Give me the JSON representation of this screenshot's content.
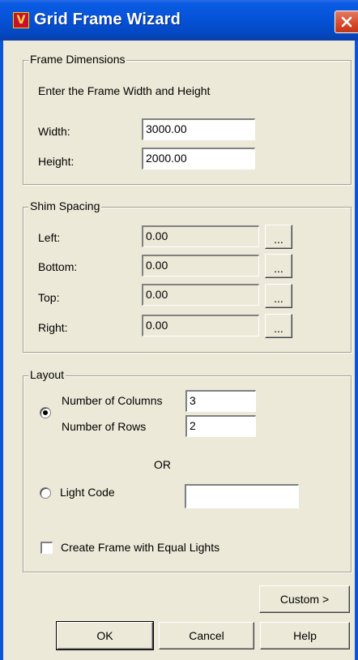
{
  "window": {
    "title": "Grid Frame Wizard",
    "icon": "app-logo-icon",
    "icon_letter": "V",
    "close_icon": "close-icon"
  },
  "frame_dimensions": {
    "group_label": "Frame Dimensions",
    "instructions": "Enter the Frame Width and Height",
    "width_label": "Width:",
    "width_value": "3000.00",
    "height_label": "Height:",
    "height_value": "2000.00"
  },
  "shim_spacing": {
    "group_label": "Shim Spacing",
    "rows": [
      {
        "label": "Left:",
        "value": "0.00",
        "button": "..."
      },
      {
        "label": "Bottom:",
        "value": "0.00",
        "button": "..."
      },
      {
        "label": "Top:",
        "value": "0.00",
        "button": "..."
      },
      {
        "label": "Right:",
        "value": "0.00",
        "button": "..."
      }
    ]
  },
  "layout": {
    "group_label": "Layout",
    "columns_label": "Number of Columns",
    "columns_value": "3",
    "rows_label": "Number of Rows",
    "rows_value": "2",
    "or_text": "OR",
    "light_code_label": "Light Code",
    "light_code_value": "",
    "equal_lights_label": "Create Frame with Equal Lights",
    "grid_option_selected": true,
    "equal_lights_checked": false
  },
  "buttons": {
    "custom": "Custom >",
    "ok": "OK",
    "cancel": "Cancel",
    "help": "Help"
  },
  "colors": {
    "titlebar": "#0553d8",
    "dialog_bg": "#ece9d8",
    "close_button": "#d6492a"
  }
}
